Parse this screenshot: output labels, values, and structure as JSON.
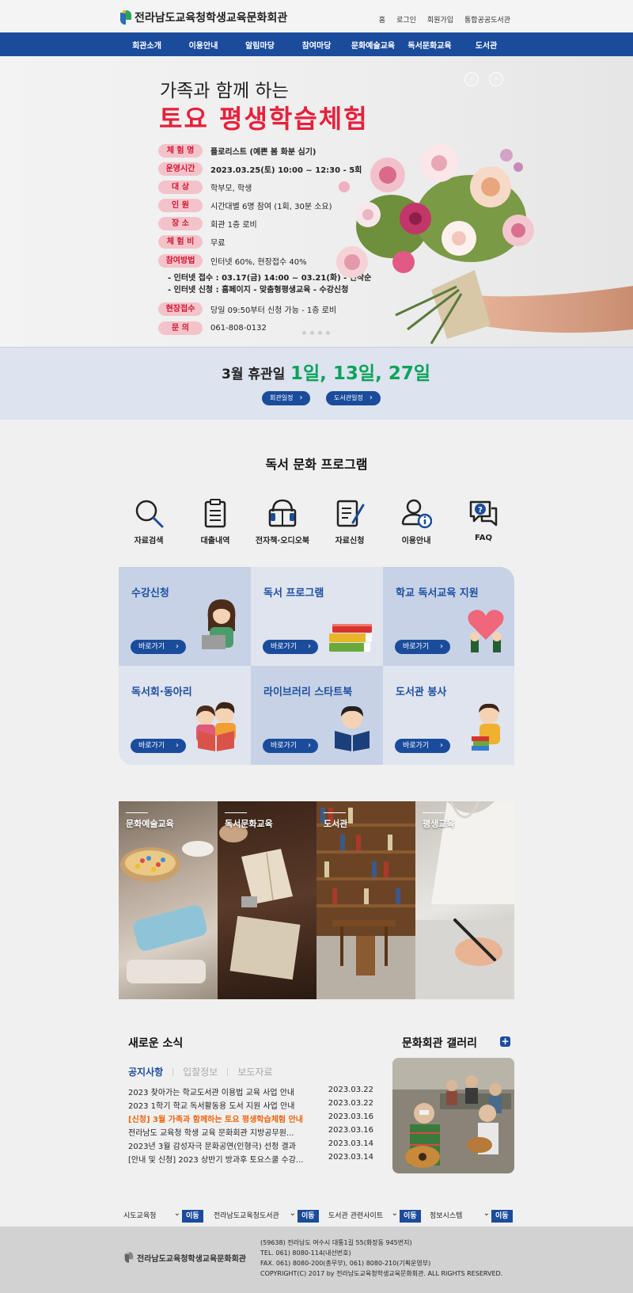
{
  "header": {
    "logo_text": "전라남도교육청학생교육문화회관",
    "links": [
      "홈",
      "로그인",
      "회원가입",
      "통합공공도서관"
    ]
  },
  "nav": {
    "items": [
      "회관소개",
      "이용안내",
      "알림마당",
      "참여마당",
      "문화예술교육",
      "독서문화교육",
      "도서관"
    ]
  },
  "hero": {
    "pre_title": "가족과 함께 하는",
    "title": "토요 평생학습체험",
    "arrows": [
      "‹",
      "›"
    ],
    "rows": [
      {
        "label": "체 험 명",
        "value": "플로리스트 (예쁜 봄 화분 심기)"
      },
      {
        "label": "운영시간",
        "value": "2023.03.25(토) 10:00 ~ 12:30 - 5회"
      },
      {
        "label": "대     상",
        "value": "학부모, 학생"
      },
      {
        "label": "인     원",
        "value": "시간대별 6명 참여 (1회, 30분 소요)"
      },
      {
        "label": "장     소",
        "value": "회관 1층 로비"
      },
      {
        "label": "체 험 비",
        "value": "무료"
      },
      {
        "label": "참여방법",
        "value": "인터넷 60%, 현장접수 40%"
      },
      {
        "label": "현장접수",
        "value": "당일 09:50부터 신청 가능 - 1층 로비"
      },
      {
        "label": "문     의",
        "value": "061-808-0132"
      }
    ],
    "sublines": [
      "- 인터넷 접수 : 03.17(금) 14:00 ~ 03.21(화) - 선착순",
      "- 인터넷 신청 : 홈페이지 - 맞춤형평생교육 - 수강신청"
    ]
  },
  "closure": {
    "label": "3월 휴관일",
    "days": "1일, 13일, 27일",
    "buttons": [
      "회관일정",
      "도서관일정"
    ]
  },
  "program": {
    "title": "독서 문화 프로그램",
    "quick_links": [
      "자료검색",
      "대출내역",
      "전자책·오디오북",
      "자료신청",
      "이용안내",
      "FAQ"
    ]
  },
  "cards": {
    "go_label": "바로가기",
    "items": [
      {
        "title": "수강신청"
      },
      {
        "title": "독서 프로그램"
      },
      {
        "title": "학교 독서교육 지원"
      },
      {
        "title": "독서회·동아리"
      },
      {
        "title": "라이브러리 스타트북"
      },
      {
        "title": "도서관 봉사"
      }
    ]
  },
  "photo_tiles": [
    "문화예술교육",
    "독서문화교육",
    "도서관",
    "평생교육"
  ],
  "news": {
    "title": "새로운 소식",
    "tabs": [
      "공지사항",
      "입찰정보",
      "보도자료"
    ],
    "items": [
      {
        "title": "2023 찾아가는 학교도서관 이용법 교육 사업 안내",
        "date": "2023.03.22"
      },
      {
        "title": "2023 1학기 학교 독서활동용 도서 지원 사업 안내",
        "date": "2023.03.22"
      },
      {
        "title": "[신청] 3월 가족과 함께하는 토요 평생학습체험 안내",
        "date": "2023.03.16"
      },
      {
        "title": "전라남도 교육청 학생 교육 문화회관 지방공무원...",
        "date": "2023.03.16"
      },
      {
        "title": "2023년 3월 감성자극 문화공연(인형극) 선정 결과",
        "date": "2023.03.14"
      },
      {
        "title": "[안내 및 신청] 2023 상반기 방과후 토요스쿨 수강...",
        "date": "2023.03.14"
      }
    ]
  },
  "gallery": {
    "title": "문화회관 갤러리",
    "plus": "+"
  },
  "site_selects": {
    "options": [
      "시도교육청",
      "전라남도교육청도서관",
      "도서관 관련사이트",
      "정보시스템"
    ],
    "go_label": "이동"
  },
  "footer": {
    "logo_text": "전라남도교육청학생교육문화회관",
    "lines": [
      "(59638) 전라남도 여수시 대통1길 55(화장동 945번지)",
      "TEL. 061) 8080-114(내선번호)",
      "FAX. 061) 8080-200(총무부), 061) 8080-210(기획운영부)",
      "COPYRIGHT(C) 2017 by 전라남도교육청학생교육문화회관. ALL RIGHTS RESERVED."
    ]
  },
  "colors": {
    "brand_blue": "#1b4c9c",
    "accent_red": "#e8203a",
    "green": "#0ba25a",
    "highlight_orange": "#ee6611"
  }
}
